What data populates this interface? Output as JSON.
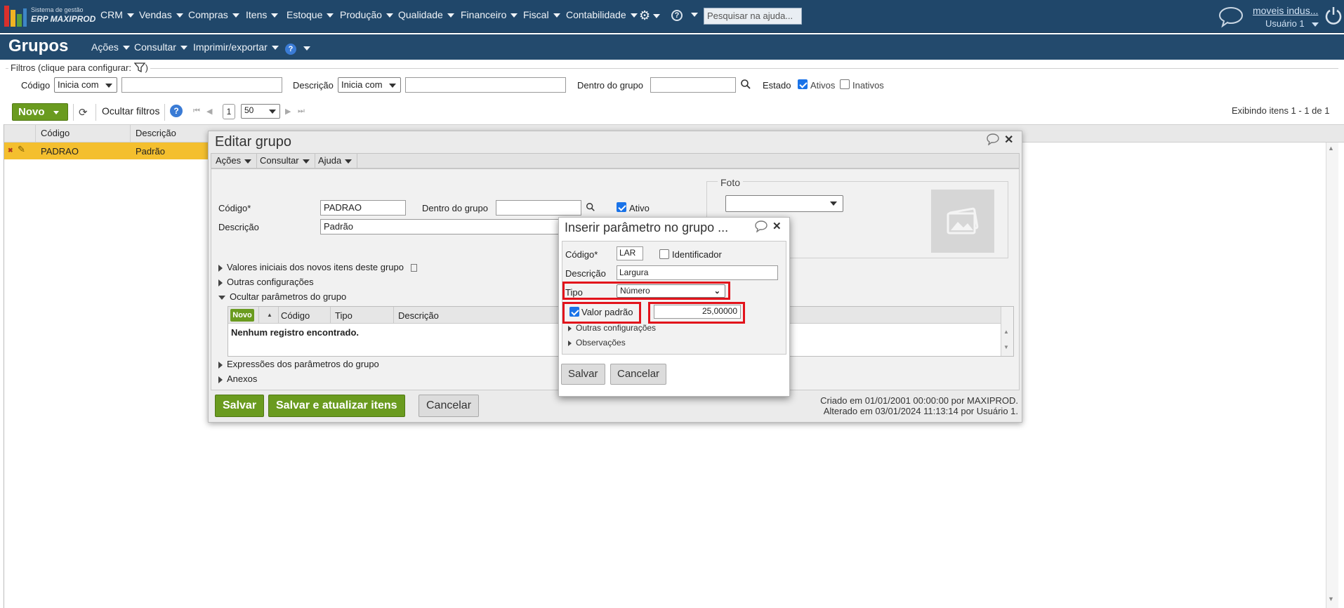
{
  "app": {
    "logo_line1": "Sistema de gestão",
    "logo_line2": "ERP MAXIPROD",
    "menu": [
      "CRM",
      "Vendas",
      "Compras",
      "Itens",
      "Estoque",
      "Produção",
      "Qualidade",
      "Financeiro",
      "Fiscal",
      "Contabilidade"
    ],
    "help_search_placeholder": "Pesquisar na ajuda...",
    "company_link": "moveis indus...",
    "user_name": "Usuário 1"
  },
  "page": {
    "title": "Grupos",
    "menu": [
      "Ações",
      "Consultar",
      "Imprimir/exportar"
    ]
  },
  "filters": {
    "legend": "Filtros (clique para configurar:",
    "legend_end": ")",
    "codigo_label": "Código",
    "codigo_mode": "Inicia com",
    "descricao_label": "Descrição",
    "descricao_mode": "Inicia com",
    "dentro_label": "Dentro do grupo",
    "estado_label": "Estado",
    "ativos_label": "Ativos",
    "ativos_checked": true,
    "inativos_label": "Inativos",
    "inativos_checked": false
  },
  "toolbar": {
    "novo_label": "Novo",
    "ocultar_filtros": "Ocultar filtros",
    "page_number": "1",
    "page_size": "50",
    "showing": "Exibindo itens 1 - 1 de 1"
  },
  "grid": {
    "columns": [
      "Código",
      "Descrição"
    ],
    "rows": [
      {
        "codigo": "PADRAO",
        "descricao": "Padrão"
      }
    ]
  },
  "editar_grupo": {
    "title": "Editar grupo",
    "menu": [
      "Ações",
      "Consultar",
      "Ajuda"
    ],
    "codigo_label": "Código*",
    "codigo_value": "PADRAO",
    "dentro_label": "Dentro do grupo",
    "ativo_label": "Ativo",
    "ativo_checked": true,
    "descricao_label": "Descrição",
    "descricao_value": "Padrão",
    "foto_label": "Foto",
    "sections": {
      "valores_iniciais": "Valores iniciais dos novos itens deste grupo",
      "outras_config": "Outras configurações",
      "ocultar_param": "Ocultar parâmetros do grupo",
      "expressoes": "Expressões dos parâmetros do grupo",
      "anexos": "Anexos"
    },
    "param_grid": {
      "novo": "Novo",
      "columns": [
        "Código",
        "Tipo",
        "Descrição"
      ],
      "empty": "Nenhum registro encontrado."
    },
    "buttons": {
      "salvar": "Salvar",
      "salvar_atualizar": "Salvar e atualizar itens",
      "cancelar": "Cancelar"
    },
    "criado": "Criado em 01/01/2001 00:00:00 por MAXIPROD.",
    "alterado": "Alterado em 03/01/2024 11:13:14 por Usuário 1."
  },
  "inserir_parametro": {
    "title": "Inserir parâmetro no grupo ...",
    "codigo_label": "Código*",
    "codigo_value": "LAR",
    "identificador_label": "Identificador",
    "identificador_checked": false,
    "descricao_label": "Descrição",
    "descricao_value": "Largura",
    "tipo_label": "Tipo",
    "tipo_value": "Número",
    "valor_padrao_label": "Valor padrão",
    "valor_padrao_checked": true,
    "valor_padrao_value": "25,00000",
    "outras_config": "Outras configurações",
    "observacoes": "Observações",
    "salvar": "Salvar",
    "cancelar": "Cancelar"
  },
  "colors": {
    "topbar": "#20476a",
    "accent_green": "#6a9b1f",
    "row_selected": "#f4bf2e",
    "highlight_red": "#e2131b"
  }
}
